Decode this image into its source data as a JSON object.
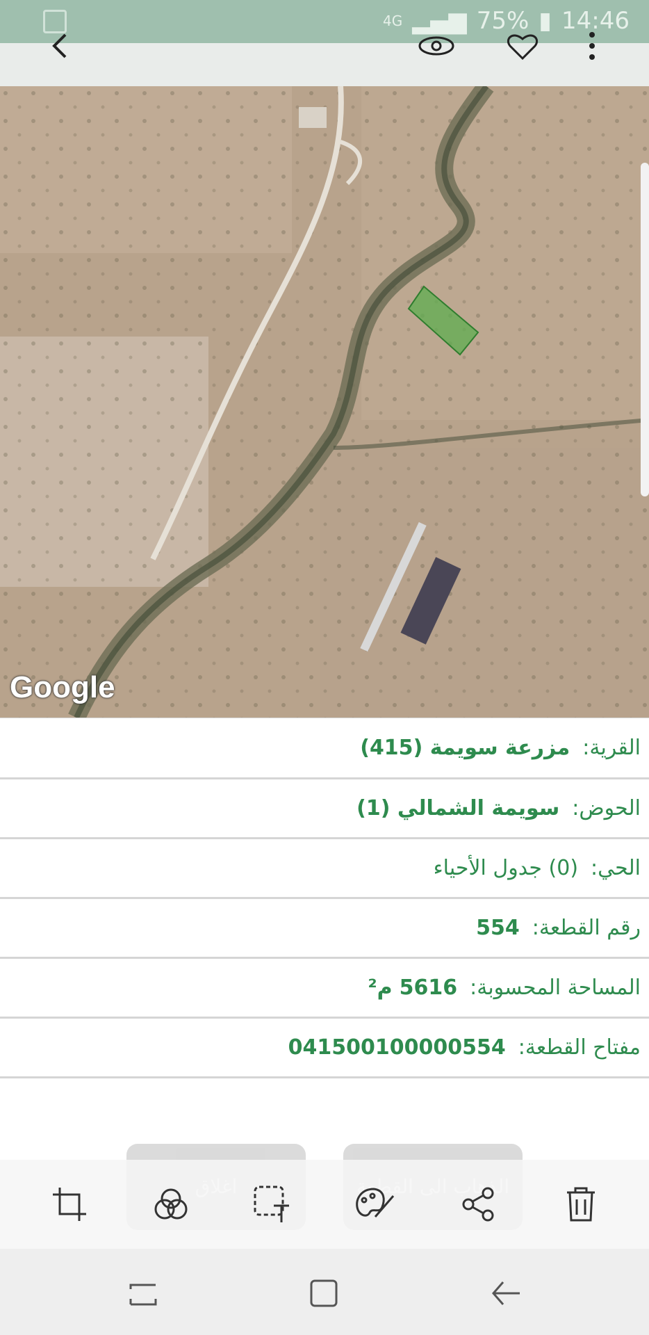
{
  "status_bar": {
    "network": "4G",
    "battery": "75%",
    "time": "14:46"
  },
  "map": {
    "attribution": "Google"
  },
  "parcel": {
    "rows": [
      {
        "label": "القرية:",
        "value": "مزرعة سويمة (415)"
      },
      {
        "label": "الحوض:",
        "value": "سويمة الشمالي (1)"
      },
      {
        "label": "الحي:",
        "value": "(0) جدول الأحياء"
      },
      {
        "label": "رقم القطعة:",
        "value": "554"
      },
      {
        "label": "المساحة المحسوبة:",
        "value": "5616",
        "unit": "م²"
      },
      {
        "label": "مفتاح القطعة:",
        "value": "041500100000554"
      }
    ]
  },
  "actions": {
    "close": "اغلاق",
    "goto": "الذهاب الى القطعة"
  },
  "icons": {
    "top": [
      "back-icon",
      "view-icon",
      "favorite-icon",
      "more-icon"
    ],
    "edit": [
      "crop-icon",
      "filter-icon",
      "text-select-icon",
      "draw-icon",
      "share-icon",
      "delete-icon"
    ],
    "nav": [
      "recents-icon",
      "home-icon",
      "nav-back-icon"
    ]
  },
  "colors": {
    "accent": "#2e8b4e",
    "status_bar": "#9fbfae",
    "parcel_fill": "#5fae50"
  }
}
